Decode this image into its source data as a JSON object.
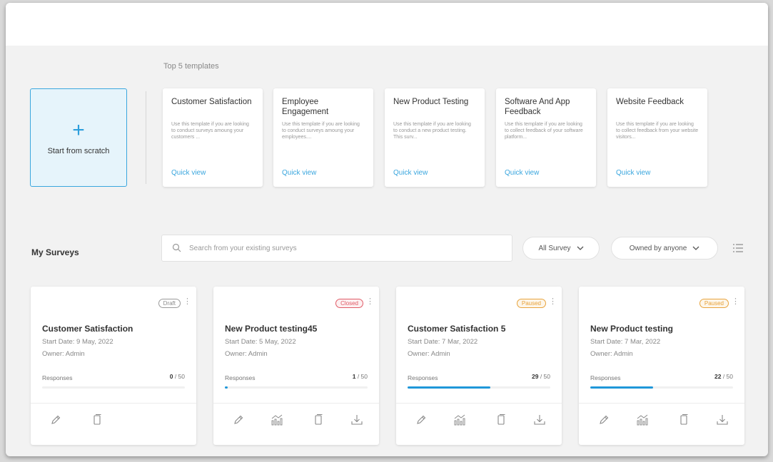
{
  "templates": {
    "heading": "Top 5 templates",
    "start_scratch": "Start from scratch",
    "items": [
      {
        "title": "Customer Satisfaction",
        "desc": "Use this template if you are looking to conduct surveys amoung your customers ...",
        "link": "Quick view"
      },
      {
        "title": "Employee Engagement",
        "desc": "Use this template if you are looking to conduct surveys amoung your employees....",
        "link": "Quick view"
      },
      {
        "title": "New Product Testing",
        "desc": "Use this template if you are looking to conduct a new product testing. This surv...",
        "link": "Quick view"
      },
      {
        "title": "Software And App Feedback",
        "desc": "Use this template if you are looking to collect feedback of your software platform...",
        "link": "Quick view"
      },
      {
        "title": "Website Feedback",
        "desc": "Use this template if you are looking to collect feedback from your website visitors...",
        "link": "Quick view"
      }
    ]
  },
  "surveys": {
    "label": "My Surveys",
    "search_placeholder": "Search from your existing surveys",
    "filter_type": "All Survey",
    "filter_owner": "Owned by anyone",
    "items": [
      {
        "status": "Draft",
        "title": "Customer Satisfaction",
        "start": "Start Date: 9 May, 2022",
        "owner": "Owner: Admin",
        "responses_label": "Responses",
        "responses": "0",
        "total": " / 50",
        "progress": 0
      },
      {
        "status": "Closed",
        "title": "New Product testing45",
        "start": "Start Date: 5 May, 2022",
        "owner": "Owner: Admin",
        "responses_label": "Responses",
        "responses": "1",
        "total": " / 50",
        "progress": 0.02
      },
      {
        "status": "Paused",
        "title": "Customer Satisfaction 5",
        "start": "Start Date: 7 Mar, 2022",
        "owner": "Owner: Admin",
        "responses_label": "Responses",
        "responses": "29",
        "total": " / 50",
        "progress": 0.58
      },
      {
        "status": "Paused",
        "title": "New Product testing",
        "start": "Start Date: 7 Mar, 2022",
        "owner": "Owner: Admin",
        "responses_label": "Responses",
        "responses": "22",
        "total": " / 50",
        "progress": 0.44
      }
    ]
  },
  "colors": {
    "accent": "#2d9fdc",
    "draft": "#8a8a8a",
    "closed": "#e05a66",
    "paused": "#e8a33c"
  }
}
